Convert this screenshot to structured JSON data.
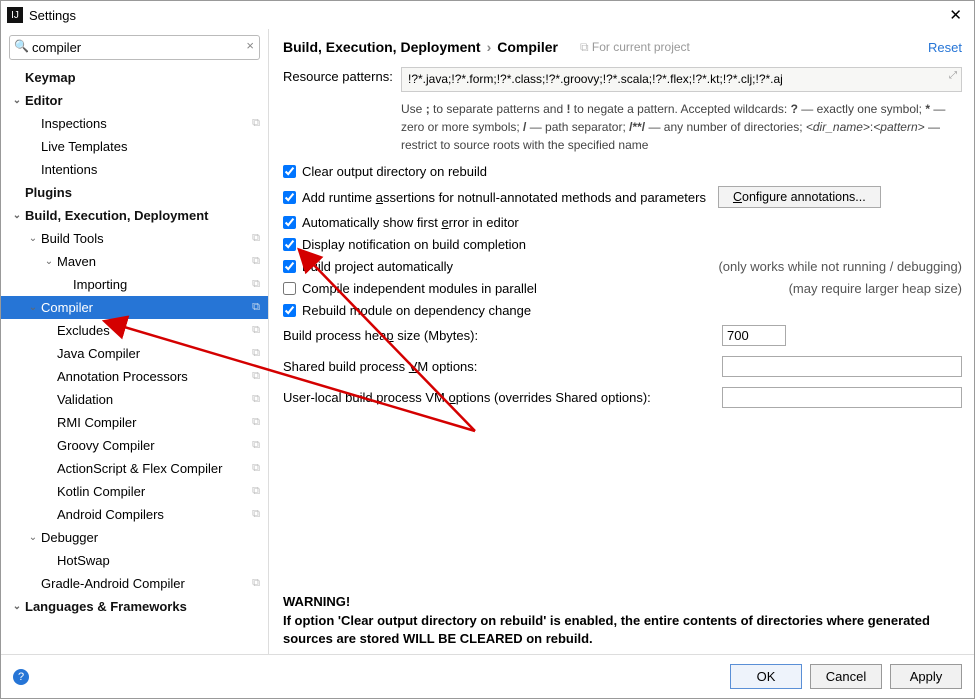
{
  "window": {
    "title": "Settings"
  },
  "search": {
    "value": "compiler"
  },
  "breadcrumb": {
    "parent": "Build, Execution, Deployment",
    "current": "Compiler",
    "scope": "For current project",
    "reset": "Reset"
  },
  "sidebar": {
    "items": [
      {
        "label": "Keymap",
        "bold": true,
        "indent": 0,
        "chev": ""
      },
      {
        "label": "Editor",
        "bold": true,
        "indent": 0,
        "chev": "v"
      },
      {
        "label": "Inspections",
        "indent": 1,
        "copy": true
      },
      {
        "label": "Live Templates",
        "indent": 1
      },
      {
        "label": "Intentions",
        "indent": 1
      },
      {
        "label": "Plugins",
        "bold": true,
        "indent": 0
      },
      {
        "label": "Build, Execution, Deployment",
        "bold": true,
        "indent": 0,
        "chev": "v"
      },
      {
        "label": "Build Tools",
        "indent": 1,
        "chev": "v",
        "copy": true
      },
      {
        "label": "Maven",
        "indent": 2,
        "chev": "v",
        "copy": true
      },
      {
        "label": "Importing",
        "indent": 3,
        "copy": true
      },
      {
        "label": "Compiler",
        "indent": 1,
        "chev": "v",
        "copy": true,
        "selected": true
      },
      {
        "label": "Excludes",
        "indent": 2,
        "copy": true
      },
      {
        "label": "Java Compiler",
        "indent": 2,
        "copy": true
      },
      {
        "label": "Annotation Processors",
        "indent": 2,
        "copy": true
      },
      {
        "label": "Validation",
        "indent": 2,
        "copy": true
      },
      {
        "label": "RMI Compiler",
        "indent": 2,
        "copy": true
      },
      {
        "label": "Groovy Compiler",
        "indent": 2,
        "copy": true
      },
      {
        "label": "ActionScript & Flex Compiler",
        "indent": 2,
        "copy": true
      },
      {
        "label": "Kotlin Compiler",
        "indent": 2,
        "copy": true
      },
      {
        "label": "Android Compilers",
        "indent": 2,
        "copy": true
      },
      {
        "label": "Debugger",
        "indent": 1,
        "chev": "v"
      },
      {
        "label": "HotSwap",
        "indent": 2
      },
      {
        "label": "Gradle-Android Compiler",
        "indent": 1,
        "copy": true
      },
      {
        "label": "Languages & Frameworks",
        "bold": true,
        "indent": 0,
        "chev": "v"
      }
    ]
  },
  "form": {
    "resource_label": "Resource patterns:",
    "resource_value": "!?*.java;!?*.form;!?*.class;!?*.groovy;!?*.scala;!?*.flex;!?*.kt;!?*.clj;!?*.aj",
    "resource_help": "Use ; to separate patterns and ! to negate a pattern. Accepted wildcards: ? — exactly one symbol; * — zero or more symbols; / — path separator; /**/ — any number of directories; <dir_name>:<pattern> — restrict to source roots with the specified name",
    "clear_output": "Clear output directory on rebuild",
    "add_runtime": "Add runtime assertions for notnull-annotated methods and parameters",
    "configure_btn": "Configure annotations...",
    "auto_show": "Automatically show first error in editor",
    "display_notif": "Display notification on build completion",
    "build_auto": "Build project automatically",
    "build_auto_hint": "(only works while not running / debugging)",
    "compile_parallel": "Compile independent modules in parallel",
    "compile_parallel_hint": "(may require larger heap size)",
    "rebuild_dep": "Rebuild module on dependency change",
    "heap_label": "Build process heap size (Mbytes):",
    "heap_value": "700",
    "shared_vm_label": "Shared build process VM options:",
    "shared_vm_value": "",
    "user_vm_label": "User-local build process VM options (overrides Shared options):",
    "user_vm_value": "",
    "warning_title": "WARNING!",
    "warning_text": "If option 'Clear output directory on rebuild' is enabled, the entire contents of directories where generated sources are stored WILL BE CLEARED on rebuild."
  },
  "footer": {
    "ok": "OK",
    "cancel": "Cancel",
    "apply": "Apply"
  }
}
